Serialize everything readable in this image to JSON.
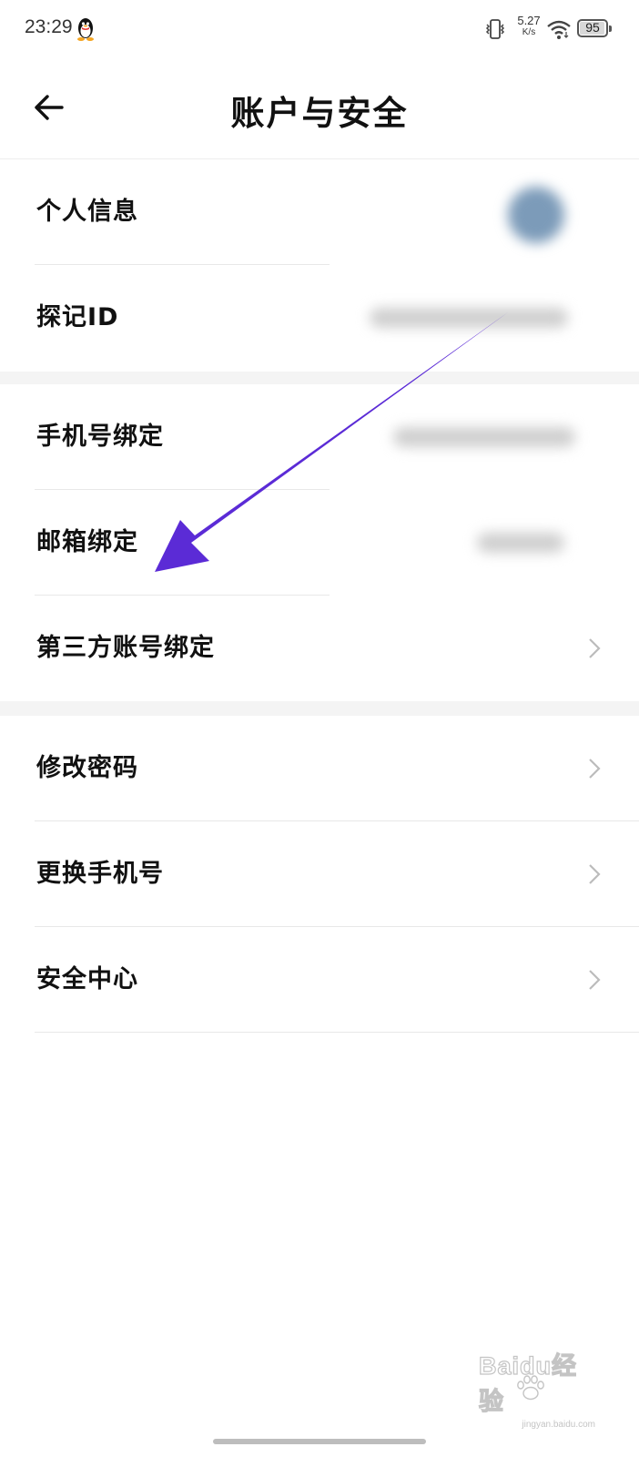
{
  "status_bar": {
    "time": "23:29",
    "net_speed_value": "5.27",
    "net_speed_unit": "K/s",
    "battery": "95",
    "battery_level": 0.95,
    "icons": [
      "qq-penguin-icon",
      "vibrate-icon",
      "wifi-icon",
      "battery-icon"
    ]
  },
  "header": {
    "title": "账户与安全",
    "back_icon": "arrow-left-icon"
  },
  "section1": {
    "rows": [
      {
        "label": "个人信息"
      },
      {
        "label": "探记ID"
      }
    ]
  },
  "section2": {
    "rows": [
      {
        "label": "手机号绑定"
      },
      {
        "label": "邮箱绑定"
      },
      {
        "label": "第三方账号绑定"
      }
    ]
  },
  "section3": {
    "rows": [
      {
        "label": "修改密码"
      },
      {
        "label": "更换手机号"
      },
      {
        "label": "安全中心"
      }
    ]
  },
  "annotation": {
    "color": "#5b2bd6",
    "icon": "annotation-arrow"
  },
  "watermark": {
    "text": "Baidu经验",
    "sub": "jingyan.baidu.com"
  }
}
